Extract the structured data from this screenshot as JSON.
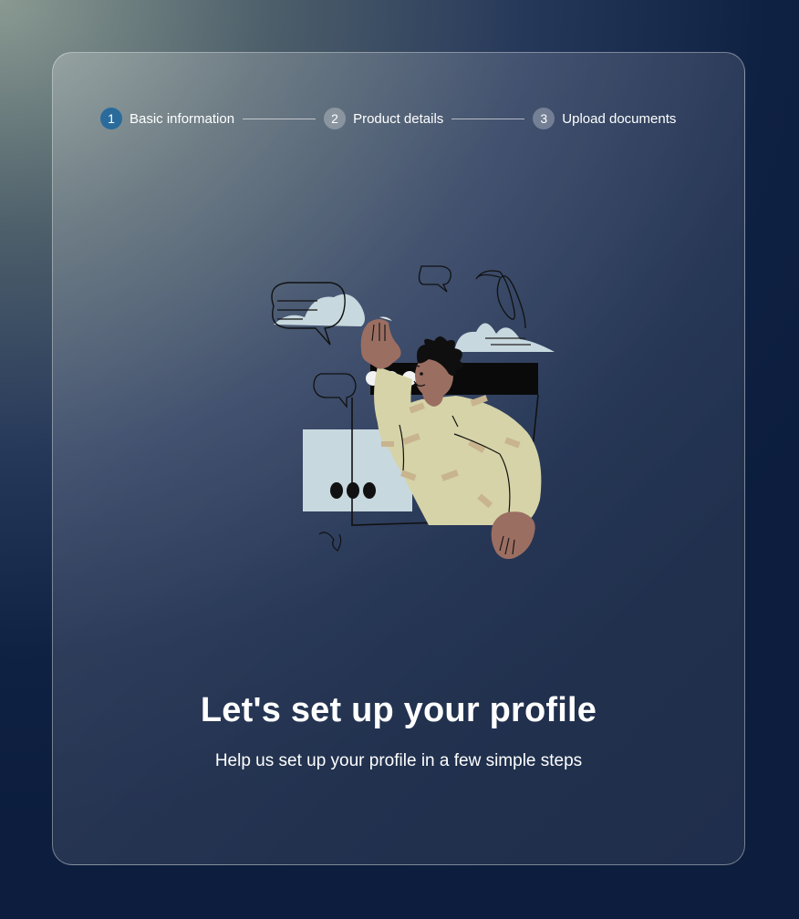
{
  "stepper": {
    "steps": [
      {
        "number": "1",
        "label": "Basic information",
        "state": "active"
      },
      {
        "number": "2",
        "label": "Product details",
        "state": "upcoming"
      },
      {
        "number": "3",
        "label": "Upload documents",
        "state": "upcoming"
      }
    ]
  },
  "main": {
    "title": "Let's set up your profile",
    "subtitle": "Help us set up your profile in a few simple steps"
  },
  "colors": {
    "active_step": "#2a6b9c",
    "background_dark": "#0c1d3d",
    "sweater": "#d6d3a8",
    "skin": "#9b6e62",
    "cloud": "#c7d8df"
  },
  "icons": {
    "hero": "person-waving-from-window-illustration"
  }
}
